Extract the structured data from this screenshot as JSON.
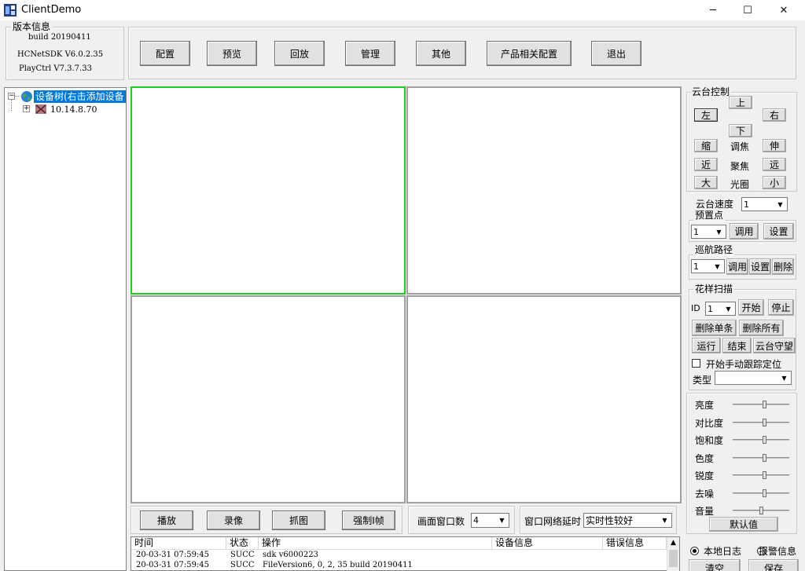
{
  "window": {
    "title": "ClientDemo",
    "minimize_glyph": "─",
    "maximize_glyph": "☐",
    "close_glyph": "✕"
  },
  "version_info": {
    "legend": "版本信息",
    "build": "build 20190411",
    "sdk": "HCNetSDK V6.0.2.35",
    "playctrl": "PlayCtrl V7.3.7.33"
  },
  "toolbar": {
    "config": "配置",
    "preview": "预览",
    "playback": "回放",
    "manage": "管理",
    "other": "其他",
    "product_config": "产品相关配置",
    "exit": "退出"
  },
  "device_tree": {
    "root_label": "设备树(右击添加设备",
    "device_ip": "10.14.8.70",
    "expand_glyph_root": "−",
    "expand_glyph_child": "+"
  },
  "ptz": {
    "legend": "云台控制",
    "up": "上",
    "left": "左",
    "right": "右",
    "down": "下",
    "zoom_in": "缩",
    "zoom_label": "调焦",
    "zoom_out": "伸",
    "near": "近",
    "focus_label": "聚焦",
    "far": "远",
    "big": "大",
    "iris_label": "光圈",
    "small": "小",
    "speed_label": "云台速度",
    "speed_value": "1"
  },
  "preset": {
    "legend": "预置点",
    "value": "1",
    "call": "调用",
    "set": "设置"
  },
  "cruise": {
    "legend": "巡航路径",
    "value": "1",
    "call": "调用",
    "set": "设置",
    "delete": "删除"
  },
  "pattern": {
    "legend": "花样扫描",
    "id_label": "ID",
    "id_value": "1",
    "start": "开始",
    "stop": "停止",
    "delete_one": "删除单条",
    "delete_all": "删除所有",
    "run": "运行",
    "end": "结束",
    "guard": "云台守望",
    "manual_track": "开始手动跟踪定位",
    "type_label": "类型",
    "type_value": ""
  },
  "image_params": {
    "items": [
      {
        "label": "亮度",
        "level": 0.55
      },
      {
        "label": "对比度",
        "level": 0.55
      },
      {
        "label": "饱和度",
        "level": 0.55
      },
      {
        "label": "色度",
        "level": 0.55
      },
      {
        "label": "锐度",
        "level": 0.55
      },
      {
        "label": "去噪",
        "level": 0.55
      },
      {
        "label": "音量",
        "level": 0.5
      }
    ],
    "default_button": "默认值"
  },
  "log_panel": {
    "local_log": "本地日志",
    "alarm_info": "报警信息",
    "clear": "清空",
    "save": "保存"
  },
  "bottom_bar": {
    "play": "播放",
    "record": "录像",
    "capture": "抓图",
    "force_iframe": "强制I帧",
    "window_count_label": "画面窗口数",
    "window_count_value": "4",
    "delay_label": "窗口网络延时",
    "delay_value": "实时性较好"
  },
  "log_table": {
    "headers": [
      "时间",
      "状态",
      "操作",
      "设备信息",
      "错误信息"
    ],
    "rows": [
      [
        "20-03-31 07:59:45",
        "SUCC",
        "sdk v6000223",
        "",
        ""
      ],
      [
        "20-03-31 07:59:45",
        "SUCC",
        "FileVersion6, 0, 2, 35 build 20190411",
        "",
        ""
      ]
    ]
  },
  "colors": {
    "active_window_border": "#1ed01e",
    "selection_bg": "#0078d7"
  }
}
